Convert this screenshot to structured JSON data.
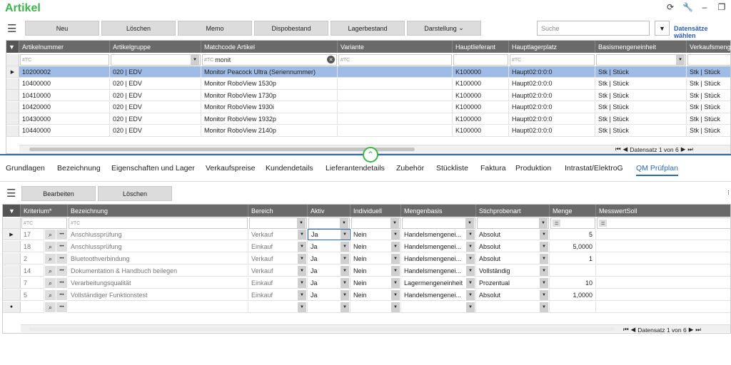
{
  "app": {
    "title": "Artikel"
  },
  "window_icons": [
    "refresh-icon",
    "wrench-icon",
    "minimize-icon",
    "restore-icon"
  ],
  "toolbar": {
    "buttons": [
      "Neu",
      "Löschen",
      "Memo",
      "Dispobestand",
      "Lagerbestand",
      "Darstellung"
    ],
    "search_placeholder": "Suche",
    "select_link": "Datensätze wählen"
  },
  "articles": {
    "columns": [
      "Artikelnummer",
      "Artikelgruppe",
      "Matchcode Artikel",
      "Variante",
      "Hauptlieferant",
      "Hauptlagerplatz",
      "Basismengeneinheit",
      "Verkaufsmenge"
    ],
    "filter_placeholder": "#TC",
    "filter_value": "monit",
    "rows": [
      [
        "10200002",
        "020 | EDV",
        "Monitor Peacock Ultra (Seriennummer)",
        "",
        "K100000",
        "Haupt02:0:0:0",
        "Stk | Stück",
        "Stk | Stück"
      ],
      [
        "10400000",
        "020 | EDV",
        "Monitor RoboView 1530p",
        "",
        "K100000",
        "Haupt02:0:0:0",
        "Stk | Stück",
        "Stk | Stück"
      ],
      [
        "10410000",
        "020 | EDV",
        "Monitor RoboView 1730p",
        "",
        "K100000",
        "Haupt02:0:0:0",
        "Stk | Stück",
        "Stk | Stück"
      ],
      [
        "10420000",
        "020 | EDV",
        "Monitor RoboView 1930i",
        "",
        "K100000",
        "Haupt02:0:0:0",
        "Stk | Stück",
        "Stk | Stück"
      ],
      [
        "10430000",
        "020 | EDV",
        "Monitor RoboView 1932p",
        "",
        "K100000",
        "Haupt02:0:0:0",
        "Stk | Stück",
        "Stk | Stück"
      ],
      [
        "10440000",
        "020 | EDV",
        "Monitor RoboView 2140p",
        "",
        "K100000",
        "Haupt02:0:0:0",
        "Stk | Stück",
        "Stk | Stück"
      ]
    ],
    "pager": "Datensatz 1 von 6"
  },
  "tabs": [
    "Grundlagen",
    "Bezeichnung",
    "Eigenschaften und Lager",
    "Verkaufspreise",
    "Kundendetails",
    "Lieferantendetails",
    "Zubehör",
    "Stückliste",
    "Faktura",
    "Produktion",
    "Intrastat/ElektroG",
    "QM Prüfplan"
  ],
  "qm": {
    "buttons": [
      "Bearbeiten",
      "Löschen"
    ],
    "columns": [
      "Kriterium*",
      "Bezeichnung",
      "Bereich",
      "Aktiv",
      "Individuell",
      "Mengenbasis",
      "Stichprobenart",
      "Menge",
      "MesswertSoll"
    ],
    "filter_placeholder": "#TC",
    "filter_eq": "=",
    "rows": [
      [
        "17",
        "Anschlussprüfung",
        "Verkauf",
        "Ja",
        "Nein",
        "Handelsmengenei...",
        "Absolut",
        "5",
        ""
      ],
      [
        "18",
        "Anschlussprüfung",
        "Einkauf",
        "Ja",
        "Nein",
        "Handelsmengenei...",
        "Absolut",
        "5,0000",
        ""
      ],
      [
        "2",
        "Bluetoothverbindung",
        "Verkauf",
        "Ja",
        "Nein",
        "Handelsmengenei...",
        "Absolut",
        "1",
        ""
      ],
      [
        "14",
        "Dokumentation & Handbuch beilegen",
        "Verkauf",
        "Ja",
        "Nein",
        "Handelsmengenei...",
        "Vollständig",
        "",
        ""
      ],
      [
        "7",
        "Verarbeitungsqualität",
        "Einkauf",
        "Ja",
        "Nein",
        "Lagermengeneinheit",
        "Prozentual",
        "10",
        ""
      ],
      [
        "5",
        "Vollständiger Funktionstest",
        "Einkauf",
        "Ja",
        "Nein",
        "Handelsmengenei...",
        "Absolut",
        "1,0000",
        ""
      ]
    ],
    "pager": "Datensatz 1 von 6"
  }
}
